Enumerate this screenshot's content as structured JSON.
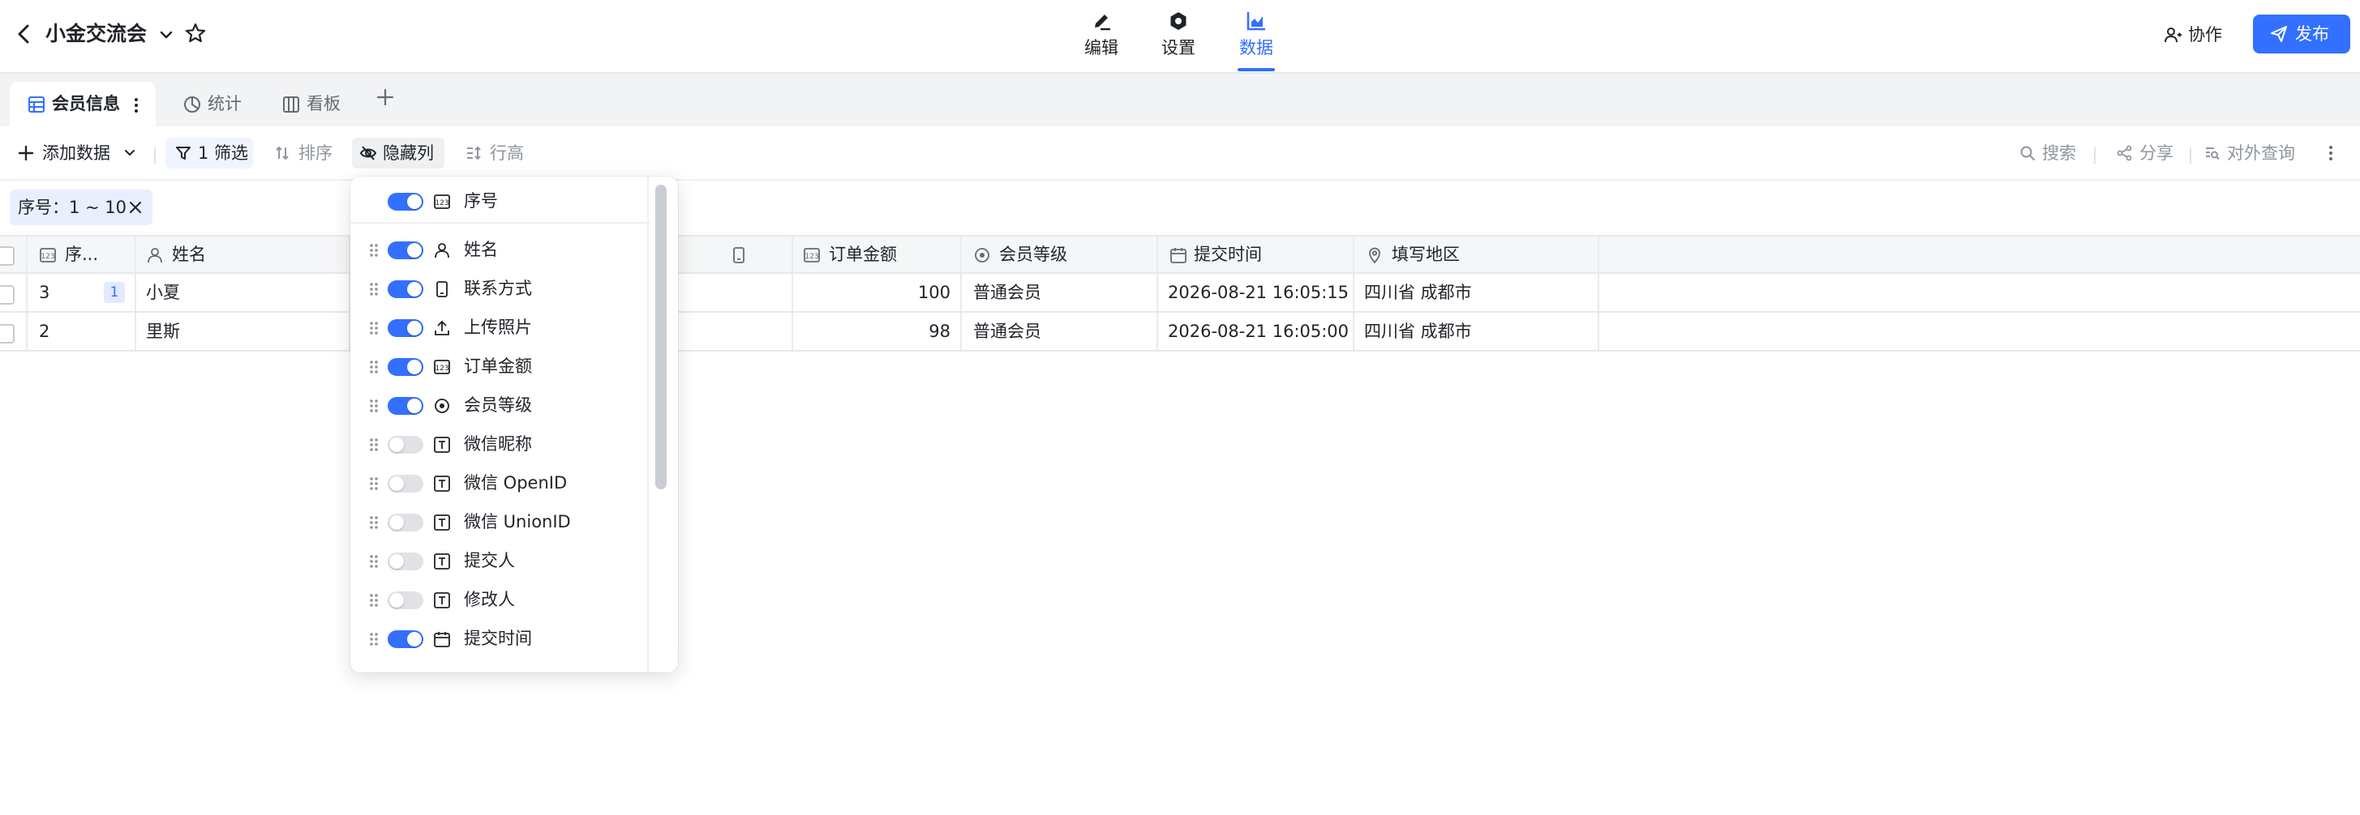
{
  "header": {
    "title": "小金交流会",
    "nav_tabs": [
      {
        "label": "编辑",
        "icon": "edit-icon"
      },
      {
        "label": "设置",
        "icon": "settings-icon"
      },
      {
        "label": "数据",
        "icon": "data-chart-icon",
        "active": true
      }
    ],
    "collab_label": "协作",
    "publish_label": "发布",
    "accent_color": "#3370ff"
  },
  "sheet_tabs": [
    {
      "label": "会员信息",
      "icon": "table-icon",
      "active": true
    },
    {
      "label": "统计",
      "icon": "pie-chart-icon"
    },
    {
      "label": "看板",
      "icon": "kanban-icon"
    }
  ],
  "toolbar": {
    "add_data_label": "添加数据",
    "filter_label": "1 筛选",
    "sort_label": "排序",
    "hide_columns_label": "隐藏列",
    "row_height_label": "行高",
    "search_label": "搜索",
    "share_label": "分享",
    "external_query_label": "对外查询"
  },
  "filter_chip": {
    "label": "序号：1 ~ 10"
  },
  "table": {
    "columns": [
      {
        "label": "序...",
        "icon": "number-field-icon"
      },
      {
        "label": "姓名",
        "icon": "person-field-icon"
      },
      {
        "label": "",
        "icon": "phone-field-icon"
      },
      {
        "label": "订单金额",
        "icon": "number-field-icon"
      },
      {
        "label": "会员等级",
        "icon": "radio-field-icon"
      },
      {
        "label": "提交时间",
        "icon": "calendar-field-icon"
      },
      {
        "label": "填写地区",
        "icon": "location-field-icon"
      }
    ],
    "rows": [
      {
        "seq": "3",
        "badge": "1",
        "name": "小夏",
        "amount": "100",
        "level": "普通会员",
        "time": "2026-08-21 16:05:15",
        "region": "四川省 成都市"
      },
      {
        "seq": "2",
        "badge": "",
        "name": "里斯",
        "amount": "98",
        "level": "普通会员",
        "time": "2026-08-21 16:05:00",
        "region": "四川省 成都市"
      }
    ]
  },
  "hidden_columns_panel": {
    "pinned": {
      "label": "序号",
      "on": true,
      "icon": "number-field-icon"
    },
    "fields": [
      {
        "label": "姓名",
        "on": true,
        "icon": "person-field-icon"
      },
      {
        "label": "联系方式",
        "on": true,
        "icon": "phone-field-icon"
      },
      {
        "label": "上传照片",
        "on": true,
        "icon": "upload-field-icon"
      },
      {
        "label": "订单金额",
        "on": true,
        "icon": "number-field-icon"
      },
      {
        "label": "会员等级",
        "on": true,
        "icon": "radio-field-icon"
      },
      {
        "label": "微信昵称",
        "on": false,
        "icon": "text-field-icon"
      },
      {
        "label": "微信 OpenID",
        "on": false,
        "icon": "text-field-icon"
      },
      {
        "label": "微信 UnionID",
        "on": false,
        "icon": "text-field-icon"
      },
      {
        "label": "提交人",
        "on": false,
        "icon": "text-field-icon"
      },
      {
        "label": "修改人",
        "on": false,
        "icon": "text-field-icon"
      },
      {
        "label": "提交时间",
        "on": true,
        "icon": "calendar-field-icon"
      }
    ]
  }
}
